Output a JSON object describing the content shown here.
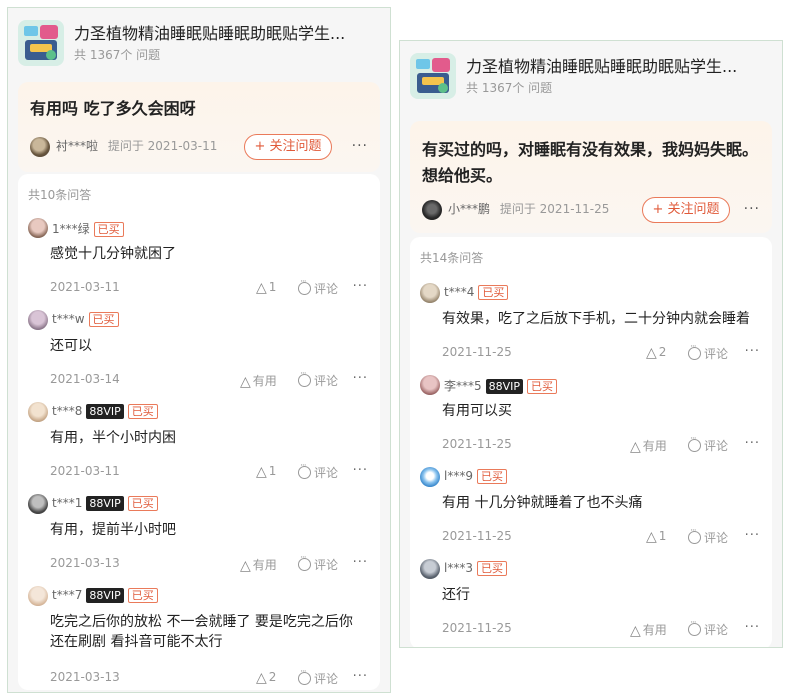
{
  "left": {
    "product": {
      "title": "力圣植物精油睡眠贴睡眠助眠贴学生...",
      "count": "共 1367个 问题"
    },
    "question": {
      "text": "有用吗  吃了多久会困呀",
      "asker": "衬***啦",
      "asked": "提问于 2021-03-11",
      "follow": "+ 关注问题",
      "more": "···"
    },
    "answers_count": "共10条问答",
    "answers": [
      {
        "user": "1***绿",
        "vip": "",
        "bought": "已买",
        "text": "感觉十几分钟就困了",
        "date": "2021-03-11",
        "like": "1",
        "comment": "评论",
        "more": "···"
      },
      {
        "user": "t***w",
        "vip": "",
        "bought": "已买",
        "text": "还可以",
        "date": "2021-03-14",
        "like": "有用",
        "comment": "评论",
        "more": "···"
      },
      {
        "user": "t***8",
        "vip": "88VIP",
        "bought": "已买",
        "text": "有用，半个小时内困",
        "date": "2021-03-11",
        "like": "1",
        "comment": "评论",
        "more": "···"
      },
      {
        "user": "t***1",
        "vip": "88VIP",
        "bought": "已买",
        "text": "有用，提前半小时吧",
        "date": "2021-03-13",
        "like": "有用",
        "comment": "评论",
        "more": "···"
      },
      {
        "user": "t***7",
        "vip": "88VIP",
        "bought": "已买",
        "text": "吃完之后你的放松 不一会就睡了 要是吃完之后你还在刷剧 看抖音可能不太行",
        "date": "2021-03-13",
        "like": "2",
        "comment": "评论",
        "more": "···"
      }
    ]
  },
  "right": {
    "product": {
      "title": "力圣植物精油睡眠贴睡眠助眠贴学生...",
      "count": "共 1367个 问题"
    },
    "question": {
      "text": "有买过的吗，对睡眠有没有效果，我妈妈失眠。想给他买。",
      "asker": "小***鹏",
      "asked": "提问于 2021-11-25",
      "follow": "+ 关注问题",
      "more": "···"
    },
    "answers_count": "共14条问答",
    "answers": [
      {
        "user": "t***4",
        "vip": "",
        "bought": "已买",
        "text": "有效果，吃了之后放下手机，二十分钟内就会睡着",
        "date": "2021-11-25",
        "like": "2",
        "comment": "评论",
        "more": "···"
      },
      {
        "user": "李***5",
        "vip": "88VIP",
        "bought": "已买",
        "text": "有用可以买",
        "date": "2021-11-25",
        "like": "有用",
        "comment": "评论",
        "more": "···"
      },
      {
        "user": "l***9",
        "vip": "",
        "bought": "已买",
        "text": "有用 十几分钟就睡着了也不头痛",
        "date": "2021-11-25",
        "like": "1",
        "comment": "评论",
        "more": "···"
      },
      {
        "user": "l***3",
        "vip": "",
        "bought": "已买",
        "text": "还行",
        "date": "2021-11-25",
        "like": "有用",
        "comment": "评论",
        "more": "···"
      }
    ]
  }
}
